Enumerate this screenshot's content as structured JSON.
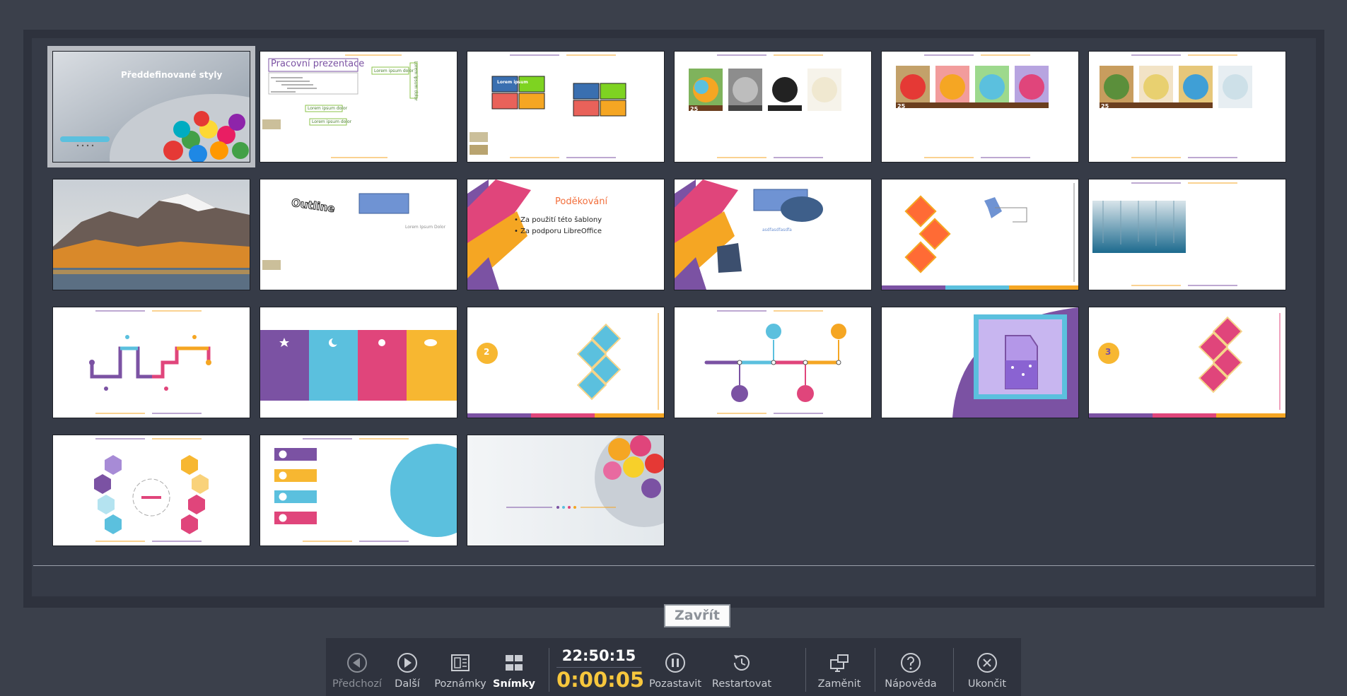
{
  "slides": [
    {
      "title": "Předdefinované styly"
    },
    {
      "title": "Pracovní prezentace",
      "callout": "Lorem ipsum dolor",
      "side": "Lorem ipsum dolor",
      "b1": "Lorem ipsum dolor",
      "b2": "Lorem ipsum dolor"
    },
    {
      "box": "Lorem ipsum"
    },
    {
      "badge": "25"
    },
    {
      "badge": "25"
    },
    {
      "badge": "25"
    },
    {},
    {
      "word": "Outline",
      "caption": "Lorem Ipsum Dolor"
    },
    {
      "title": "Poděkování",
      "bullets": [
        "Za použití této šablony",
        "Za podporu LibreOffice"
      ]
    },
    {
      "caption": "asdfasdfasdfa"
    },
    {},
    {},
    {},
    {},
    {
      "number": "2"
    },
    {},
    {},
    {
      "number": "3"
    },
    {},
    {},
    {}
  ],
  "close_label": "Zavřít",
  "toolbar": {
    "prev_label": "Předchozí",
    "next_label": "Další",
    "notes_label": "Poznámky",
    "slides_label": "Snímky",
    "clock": "22:50:15",
    "timer": "0:00:05",
    "pause_label": "Pozastavit",
    "restart_label": "Restartovat",
    "exchange_label": "Zaměnit",
    "help_label": "Nápověda",
    "exit_label": "Ukončit"
  },
  "colors": {
    "purple": "#7b52a3",
    "cyan": "#5bc0de",
    "pink": "#e0457b",
    "orange": "#f5a623",
    "accent_yellow": "#f7c73d"
  }
}
